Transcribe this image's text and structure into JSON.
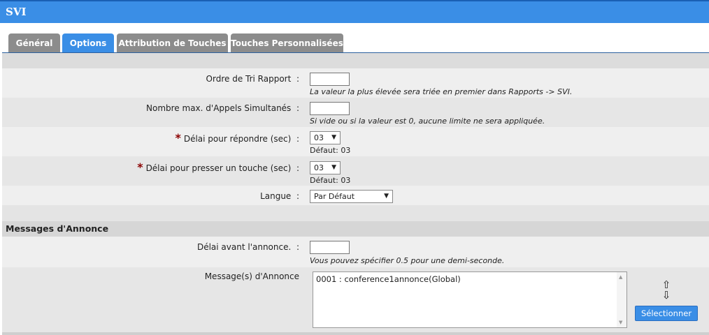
{
  "title": "SVI",
  "tabs": [
    {
      "label": "Général",
      "active": false
    },
    {
      "label": "Options",
      "active": true
    },
    {
      "label": "Attribution de Touches",
      "active": false
    },
    {
      "label": "Touches Personnalisées",
      "active": false
    }
  ],
  "fields": {
    "sort_order": {
      "label": "Ordre de Tri Rapport",
      "value": "",
      "hint": "La valeur la plus élevée sera triée en premier dans Rapports -> SVI."
    },
    "max_calls": {
      "label": "Nombre max. d'Appels Simultanés",
      "value": "",
      "hint": "Si vide ou si la valeur est 0, aucune limite ne sera appliquée."
    },
    "answer_delay": {
      "label": "Délai pour répondre (sec)",
      "value": "03",
      "default": "Défaut: 03",
      "required": true
    },
    "key_delay": {
      "label": "Délai pour presser un touche (sec)",
      "value": "03",
      "default": "Défaut: 03",
      "required": true
    },
    "language": {
      "label": "Langue",
      "value": "Par Défaut"
    }
  },
  "colon": ":",
  "announce_section": {
    "title": "Messages d'Annonce",
    "delay": {
      "label": "Délai avant l'annonce.",
      "value": "",
      "hint": "Vous pouvez spécifier 0.5 pour une demi-seconde."
    },
    "messages": {
      "label": "Message(s) d'Annonce",
      "items": [
        "0001 : conference1annonce(Global)"
      ]
    },
    "select_button": "Sélectionner",
    "move_up_icon": "⇧",
    "move_down_icon": "⇩"
  },
  "colors": {
    "accent": "#3a8ee6",
    "tab_inactive": "#8c8c8c",
    "required": "#8b0000"
  }
}
